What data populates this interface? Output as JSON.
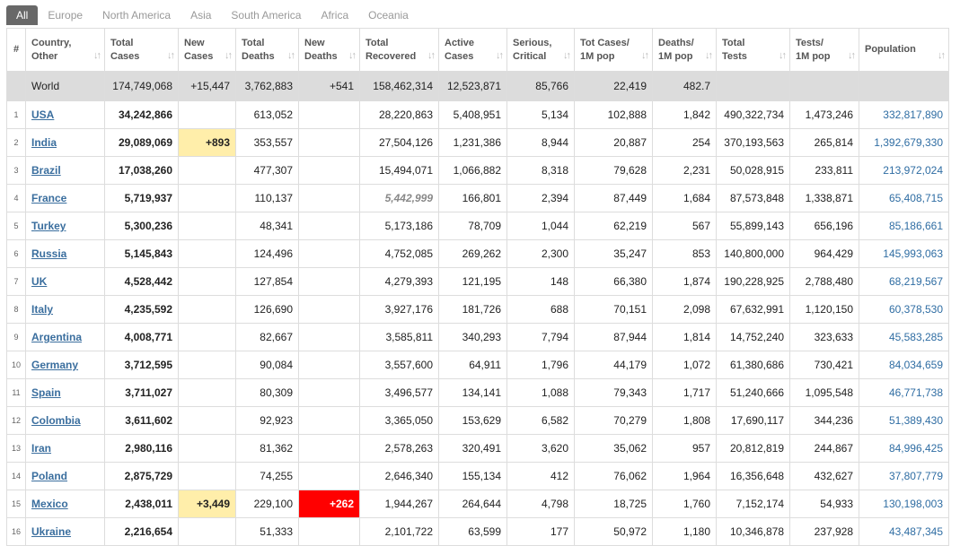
{
  "tabs": [
    "All",
    "Europe",
    "North America",
    "Asia",
    "South America",
    "Africa",
    "Oceania"
  ],
  "columns": [
    {
      "line1": "#",
      "line2": ""
    },
    {
      "line1": "Country,",
      "line2": "Other"
    },
    {
      "line1": "Total",
      "line2": "Cases"
    },
    {
      "line1": "New",
      "line2": "Cases"
    },
    {
      "line1": "Total",
      "line2": "Deaths"
    },
    {
      "line1": "New",
      "line2": "Deaths"
    },
    {
      "line1": "Total",
      "line2": "Recovered"
    },
    {
      "line1": "Active",
      "line2": "Cases"
    },
    {
      "line1": "Serious,",
      "line2": "Critical"
    },
    {
      "line1": "Tot Cases/",
      "line2": "1M pop"
    },
    {
      "line1": "Deaths/",
      "line2": "1M pop"
    },
    {
      "line1": "Total",
      "line2": "Tests"
    },
    {
      "line1": "Tests/",
      "line2": "1M pop"
    },
    {
      "line1": "Population",
      "line2": ""
    }
  ],
  "sort_glyph": "↓↑",
  "world": {
    "name": "World",
    "total_cases": "174,749,068",
    "new_cases": "+15,447",
    "total_deaths": "3,762,883",
    "new_deaths": "+541",
    "total_recovered": "158,462,314",
    "active_cases": "12,523,871",
    "serious": "85,766",
    "cases_per_m": "22,419",
    "deaths_per_m": "482.7",
    "total_tests": "",
    "tests_per_m": "",
    "population": ""
  },
  "rows": [
    {
      "idx": "1",
      "name": "USA",
      "total_cases": "34,242,866",
      "new_cases": "",
      "total_deaths": "613,052",
      "new_deaths": "",
      "total_recovered": "28,220,863",
      "active_cases": "5,408,951",
      "serious": "5,134",
      "cases_per_m": "102,888",
      "deaths_per_m": "1,842",
      "total_tests": "490,322,734",
      "tests_per_m": "1,473,246",
      "population": "332,817,890"
    },
    {
      "idx": "2",
      "name": "India",
      "total_cases": "29,089,069",
      "new_cases": "+893",
      "total_deaths": "353,557",
      "new_deaths": "",
      "total_recovered": "27,504,126",
      "active_cases": "1,231,386",
      "serious": "8,944",
      "cases_per_m": "20,887",
      "deaths_per_m": "254",
      "total_tests": "370,193,563",
      "tests_per_m": "265,814",
      "population": "1,392,679,330"
    },
    {
      "idx": "3",
      "name": "Brazil",
      "total_cases": "17,038,260",
      "new_cases": "",
      "total_deaths": "477,307",
      "new_deaths": "",
      "total_recovered": "15,494,071",
      "active_cases": "1,066,882",
      "serious": "8,318",
      "cases_per_m": "79,628",
      "deaths_per_m": "2,231",
      "total_tests": "50,028,915",
      "tests_per_m": "233,811",
      "population": "213,972,024"
    },
    {
      "idx": "4",
      "name": "France",
      "total_cases": "5,719,937",
      "new_cases": "",
      "total_deaths": "110,137",
      "new_deaths": "",
      "total_recovered": "5,442,999",
      "active_cases": "166,801",
      "serious": "2,394",
      "cases_per_m": "87,449",
      "deaths_per_m": "1,684",
      "total_tests": "87,573,848",
      "tests_per_m": "1,338,871",
      "population": "65,408,715"
    },
    {
      "idx": "5",
      "name": "Turkey",
      "total_cases": "5,300,236",
      "new_cases": "",
      "total_deaths": "48,341",
      "new_deaths": "",
      "total_recovered": "5,173,186",
      "active_cases": "78,709",
      "serious": "1,044",
      "cases_per_m": "62,219",
      "deaths_per_m": "567",
      "total_tests": "55,899,143",
      "tests_per_m": "656,196",
      "population": "85,186,661"
    },
    {
      "idx": "6",
      "name": "Russia",
      "total_cases": "5,145,843",
      "new_cases": "",
      "total_deaths": "124,496",
      "new_deaths": "",
      "total_recovered": "4,752,085",
      "active_cases": "269,262",
      "serious": "2,300",
      "cases_per_m": "35,247",
      "deaths_per_m": "853",
      "total_tests": "140,800,000",
      "tests_per_m": "964,429",
      "population": "145,993,063"
    },
    {
      "idx": "7",
      "name": "UK",
      "total_cases": "4,528,442",
      "new_cases": "",
      "total_deaths": "127,854",
      "new_deaths": "",
      "total_recovered": "4,279,393",
      "active_cases": "121,195",
      "serious": "148",
      "cases_per_m": "66,380",
      "deaths_per_m": "1,874",
      "total_tests": "190,228,925",
      "tests_per_m": "2,788,480",
      "population": "68,219,567"
    },
    {
      "idx": "8",
      "name": "Italy",
      "total_cases": "4,235,592",
      "new_cases": "",
      "total_deaths": "126,690",
      "new_deaths": "",
      "total_recovered": "3,927,176",
      "active_cases": "181,726",
      "serious": "688",
      "cases_per_m": "70,151",
      "deaths_per_m": "2,098",
      "total_tests": "67,632,991",
      "tests_per_m": "1,120,150",
      "population": "60,378,530"
    },
    {
      "idx": "9",
      "name": "Argentina",
      "total_cases": "4,008,771",
      "new_cases": "",
      "total_deaths": "82,667",
      "new_deaths": "",
      "total_recovered": "3,585,811",
      "active_cases": "340,293",
      "serious": "7,794",
      "cases_per_m": "87,944",
      "deaths_per_m": "1,814",
      "total_tests": "14,752,240",
      "tests_per_m": "323,633",
      "population": "45,583,285"
    },
    {
      "idx": "10",
      "name": "Germany",
      "total_cases": "3,712,595",
      "new_cases": "",
      "total_deaths": "90,084",
      "new_deaths": "",
      "total_recovered": "3,557,600",
      "active_cases": "64,911",
      "serious": "1,796",
      "cases_per_m": "44,179",
      "deaths_per_m": "1,072",
      "total_tests": "61,380,686",
      "tests_per_m": "730,421",
      "population": "84,034,659"
    },
    {
      "idx": "11",
      "name": "Spain",
      "total_cases": "3,711,027",
      "new_cases": "",
      "total_deaths": "80,309",
      "new_deaths": "",
      "total_recovered": "3,496,577",
      "active_cases": "134,141",
      "serious": "1,088",
      "cases_per_m": "79,343",
      "deaths_per_m": "1,717",
      "total_tests": "51,240,666",
      "tests_per_m": "1,095,548",
      "population": "46,771,738"
    },
    {
      "idx": "12",
      "name": "Colombia",
      "total_cases": "3,611,602",
      "new_cases": "",
      "total_deaths": "92,923",
      "new_deaths": "",
      "total_recovered": "3,365,050",
      "active_cases": "153,629",
      "serious": "6,582",
      "cases_per_m": "70,279",
      "deaths_per_m": "1,808",
      "total_tests": "17,690,117",
      "tests_per_m": "344,236",
      "population": "51,389,430"
    },
    {
      "idx": "13",
      "name": "Iran",
      "total_cases": "2,980,116",
      "new_cases": "",
      "total_deaths": "81,362",
      "new_deaths": "",
      "total_recovered": "2,578,263",
      "active_cases": "320,491",
      "serious": "3,620",
      "cases_per_m": "35,062",
      "deaths_per_m": "957",
      "total_tests": "20,812,819",
      "tests_per_m": "244,867",
      "population": "84,996,425"
    },
    {
      "idx": "14",
      "name": "Poland",
      "total_cases": "2,875,729",
      "new_cases": "",
      "total_deaths": "74,255",
      "new_deaths": "",
      "total_recovered": "2,646,340",
      "active_cases": "155,134",
      "serious": "412",
      "cases_per_m": "76,062",
      "deaths_per_m": "1,964",
      "total_tests": "16,356,648",
      "tests_per_m": "432,627",
      "population": "37,807,779"
    },
    {
      "idx": "15",
      "name": "Mexico",
      "total_cases": "2,438,011",
      "new_cases": "+3,449",
      "total_deaths": "229,100",
      "new_deaths": "+262",
      "total_recovered": "1,944,267",
      "active_cases": "264,644",
      "serious": "4,798",
      "cases_per_m": "18,725",
      "deaths_per_m": "1,760",
      "total_tests": "7,152,174",
      "tests_per_m": "54,933",
      "population": "130,198,003"
    },
    {
      "idx": "16",
      "name": "Ukraine",
      "total_cases": "2,216,654",
      "new_cases": "",
      "total_deaths": "51,333",
      "new_deaths": "",
      "total_recovered": "2,101,722",
      "active_cases": "63,599",
      "serious": "177",
      "cases_per_m": "50,972",
      "deaths_per_m": "1,180",
      "total_tests": "10,346,878",
      "tests_per_m": "237,928",
      "population": "43,487,345"
    }
  ],
  "colors": {
    "link": "#3a6e9e",
    "population": "#2f6da3",
    "new_cases_bg": "#ffeeaa",
    "new_deaths_bg": "#ff0000",
    "world_bg": "#dcdcdc",
    "active_tab_bg": "#686868"
  }
}
